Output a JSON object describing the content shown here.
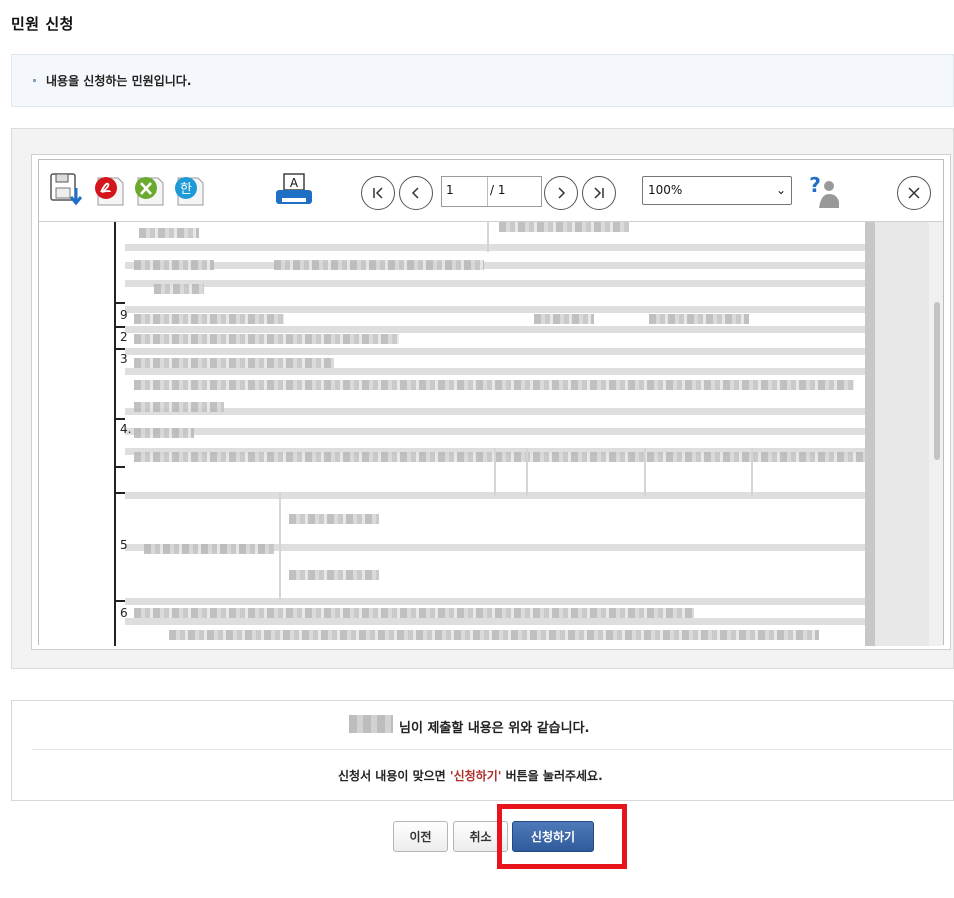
{
  "page": {
    "title": "민원 신청"
  },
  "notice": {
    "text": "내용을 신청하는 민원입니다."
  },
  "viewer": {
    "toolbar": {
      "save_icon": "save-download-icon",
      "pdf_icon": "pdf-icon",
      "excel_icon": "excel-icon",
      "hwp_icon": "hwp-icon",
      "print_icon": "print-icon",
      "first_icon": "first-page-icon",
      "prev_icon": "prev-page-icon",
      "next_icon": "next-page-icon",
      "last_icon": "last-page-icon",
      "help_icon": "help-icon",
      "close_icon": "close-icon",
      "current_page": "1",
      "total_pages": "/ 1",
      "zoom": "100%",
      "zoom_arrow": "⌄"
    },
    "document_row_numbers": [
      "9",
      "2",
      "3",
      "4.",
      "5",
      "6"
    ]
  },
  "summary": {
    "line1": "님이 제출할 내용은 위와 같습니다.",
    "line2_prefix": "신청서 내용이 맞으면 ",
    "line2_highlight": "'신청하기'",
    "line2_suffix": " 버튼을 눌러주세요."
  },
  "buttons": {
    "prev": "이전",
    "cancel": "취소",
    "submit": "신청하기"
  },
  "colors": {
    "accent_blue": "#3a65a8",
    "highlight_red": "#e8141c",
    "notice_bg": "#f4f7fb"
  }
}
